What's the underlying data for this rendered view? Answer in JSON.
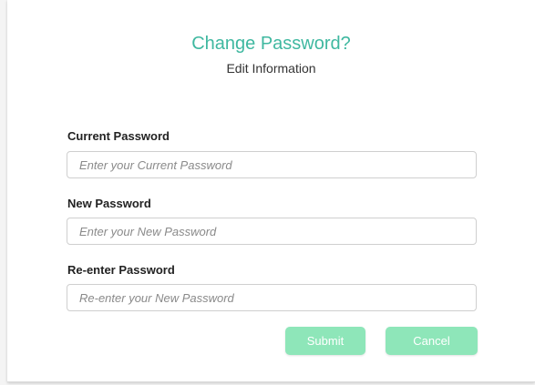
{
  "header": {
    "title": "Change Password?",
    "subtitle": "Edit Information"
  },
  "form": {
    "current_password": {
      "label": "Current Password",
      "value": "",
      "placeholder": "Enter your Current Password"
    },
    "new_password": {
      "label": "New Password",
      "value": "",
      "placeholder": "Enter your New Password"
    },
    "reenter_password": {
      "label": "Re-enter Password",
      "value": "",
      "placeholder": "Re-enter your New Password"
    }
  },
  "actions": {
    "submit_label": "Submit",
    "cancel_label": "Cancel"
  },
  "colors": {
    "title": "#3fb8a0",
    "button_bg": "#8ee6b9",
    "button_text": "#ffffff"
  }
}
